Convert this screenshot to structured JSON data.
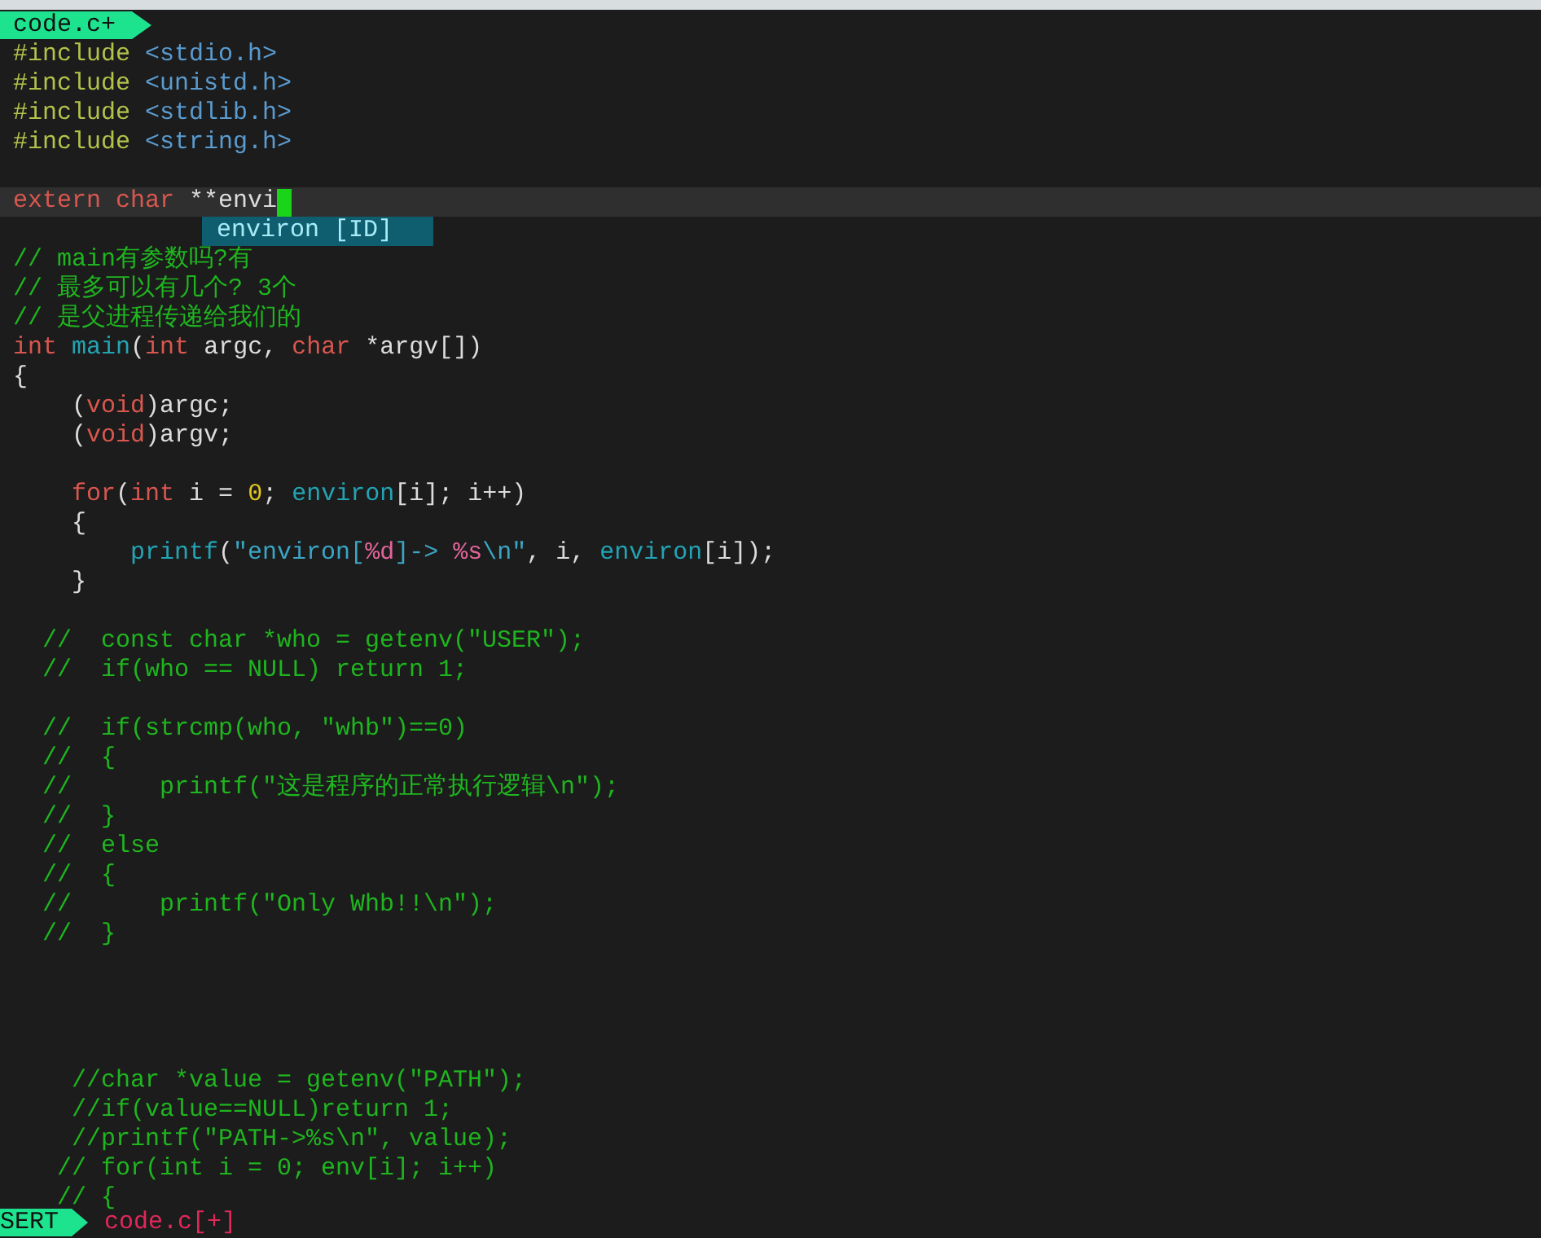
{
  "tabline": {
    "label": "code.c+"
  },
  "lines": [
    {
      "current": false,
      "tokens": [
        {
          "text": "#include ",
          "kind": "preproc"
        },
        {
          "text": "<stdio.h>",
          "kind": "header"
        }
      ]
    },
    {
      "current": false,
      "tokens": [
        {
          "text": "#include ",
          "kind": "preproc"
        },
        {
          "text": "<unistd.h>",
          "kind": "header"
        }
      ]
    },
    {
      "current": false,
      "tokens": [
        {
          "text": "#include ",
          "kind": "preproc"
        },
        {
          "text": "<stdlib.h>",
          "kind": "header"
        }
      ]
    },
    {
      "current": false,
      "tokens": [
        {
          "text": "#include ",
          "kind": "preproc"
        },
        {
          "text": "<string.h>",
          "kind": "header"
        }
      ]
    },
    {
      "current": false
    },
    {
      "current": true,
      "tokens": [
        {
          "text": "extern ",
          "kind": "keyword"
        },
        {
          "text": "char",
          "kind": "keyword"
        },
        {
          "text": " **envi",
          "kind": "plain"
        }
      ]
    },
    {
      "current": false
    },
    {
      "current": false,
      "tokens": [
        {
          "text": "// main有参数吗?有",
          "kind": "comment"
        }
      ]
    },
    {
      "current": false,
      "tokens": [
        {
          "text": "// 最多可以有几个? 3个",
          "kind": "comment"
        }
      ]
    },
    {
      "current": false,
      "tokens": [
        {
          "text": "// 是父进程传递给我们的",
          "kind": "comment"
        }
      ]
    },
    {
      "current": false,
      "tokens": [
        {
          "text": "int ",
          "kind": "keyword"
        },
        {
          "text": "main",
          "kind": "function"
        },
        {
          "text": "(",
          "kind": "plain"
        },
        {
          "text": "int",
          "kind": "keyword"
        },
        {
          "text": " argc, ",
          "kind": "plain"
        },
        {
          "text": "char",
          "kind": "keyword"
        },
        {
          "text": " *argv[])",
          "kind": "plain"
        }
      ]
    },
    {
      "current": false,
      "tokens": [
        {
          "text": "{",
          "kind": "plain"
        }
      ]
    },
    {
      "current": false,
      "tokens": [
        {
          "text": "    (",
          "kind": "plain"
        },
        {
          "text": "void",
          "kind": "keyword"
        },
        {
          "text": ")argc;",
          "kind": "plain"
        }
      ]
    },
    {
      "current": false,
      "tokens": [
        {
          "text": "    (",
          "kind": "plain"
        },
        {
          "text": "void",
          "kind": "keyword"
        },
        {
          "text": ")argv;",
          "kind": "plain"
        }
      ]
    },
    {
      "current": false
    },
    {
      "current": false,
      "tokens": [
        {
          "text": "    for",
          "kind": "keyword"
        },
        {
          "text": "(",
          "kind": "plain"
        },
        {
          "text": "int",
          "kind": "keyword"
        },
        {
          "text": " i = ",
          "kind": "plain"
        },
        {
          "text": "0",
          "kind": "number"
        },
        {
          "text": "; ",
          "kind": "plain"
        },
        {
          "text": "environ",
          "kind": "function"
        },
        {
          "text": "[i]; i++)",
          "kind": "plain"
        }
      ]
    },
    {
      "current": false,
      "tokens": [
        {
          "text": "    {",
          "kind": "plain"
        }
      ]
    },
    {
      "current": false,
      "tokens": [
        {
          "text": "        printf",
          "kind": "function"
        },
        {
          "text": "(",
          "kind": "plain"
        },
        {
          "text": "\"environ[",
          "kind": "string"
        },
        {
          "text": "%d",
          "kind": "format"
        },
        {
          "text": "]-> ",
          "kind": "string"
        },
        {
          "text": "%s",
          "kind": "format"
        },
        {
          "text": "\\n",
          "kind": "string"
        },
        {
          "text": "\"",
          "kind": "string"
        },
        {
          "text": ", i, ",
          "kind": "plain"
        },
        {
          "text": "environ",
          "kind": "function"
        },
        {
          "text": "[i]);",
          "kind": "plain"
        }
      ]
    },
    {
      "current": false,
      "tokens": [
        {
          "text": "    }",
          "kind": "plain"
        }
      ]
    },
    {
      "current": false
    },
    {
      "current": false,
      "tokens": [
        {
          "text": "  //  const char *who = getenv(\"USER\");",
          "kind": "comment"
        }
      ]
    },
    {
      "current": false,
      "tokens": [
        {
          "text": "  //  if(who == NULL) return 1;",
          "kind": "comment"
        }
      ]
    },
    {
      "current": false
    },
    {
      "current": false,
      "tokens": [
        {
          "text": "  //  if(strcmp(who, \"whb\")==0)",
          "kind": "comment"
        }
      ]
    },
    {
      "current": false,
      "tokens": [
        {
          "text": "  //  {",
          "kind": "comment"
        }
      ]
    },
    {
      "current": false,
      "tokens": [
        {
          "text": "  //      printf(\"这是程序的正常执行逻辑\\n\");",
          "kind": "comment"
        }
      ]
    },
    {
      "current": false,
      "tokens": [
        {
          "text": "  //  }",
          "kind": "comment"
        }
      ]
    },
    {
      "current": false,
      "tokens": [
        {
          "text": "  //  else",
          "kind": "comment"
        }
      ]
    },
    {
      "current": false,
      "tokens": [
        {
          "text": "  //  {",
          "kind": "comment"
        }
      ]
    },
    {
      "current": false,
      "tokens": [
        {
          "text": "  //      printf(\"Only Whb!!\\n\");",
          "kind": "comment"
        }
      ]
    },
    {
      "current": false,
      "tokens": [
        {
          "text": "  //  }",
          "kind": "comment"
        }
      ]
    },
    {
      "current": false
    },
    {
      "current": false
    },
    {
      "current": false
    },
    {
      "current": false
    },
    {
      "current": false,
      "tokens": [
        {
          "text": "    //char *value = getenv(\"PATH\");",
          "kind": "comment"
        }
      ]
    },
    {
      "current": false,
      "tokens": [
        {
          "text": "    //if(value==NULL)return 1;",
          "kind": "comment"
        }
      ]
    },
    {
      "current": false,
      "tokens": [
        {
          "text": "    //printf(\"PATH->%s\\n\", value);",
          "kind": "comment"
        }
      ]
    },
    {
      "current": false,
      "tokens": [
        {
          "text": "   // for(int i = 0; env[i]; i++)",
          "kind": "comment"
        }
      ]
    },
    {
      "current": false,
      "tokens": [
        {
          "text": "   // {",
          "kind": "comment"
        }
      ]
    }
  ],
  "completion": {
    "items": [
      {
        "label": "environ [ID]",
        "selected": true
      }
    ]
  },
  "status_line": {
    "mode": "SERT",
    "file": "code.c[+]"
  }
}
